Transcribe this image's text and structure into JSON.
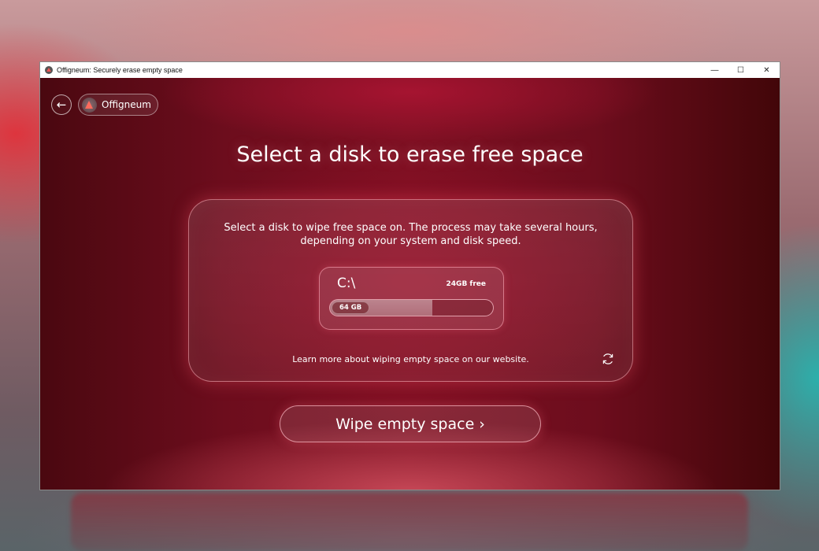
{
  "window": {
    "title": "Offigneum: Securely erase empty space",
    "controls": {
      "minimize": "—",
      "maximize": "☐",
      "close": "✕"
    }
  },
  "header": {
    "back_icon": "back-arrow-icon",
    "brand_name": "Offigneum"
  },
  "main": {
    "title": "Select a disk to erase free space",
    "description": "Select a disk to wipe free space on. The process may take several hours, depending on your system and disk speed.",
    "disk": {
      "name": "C:\\",
      "free": "24GB free",
      "size": "64 GB",
      "used_fraction": 0.63
    },
    "learn_more": "Learn more about wiping empty space on our website.",
    "refresh_icon": "refresh-icon",
    "action_label": "Wipe empty space ›"
  },
  "colors": {
    "accent": "#ff6a5c",
    "background_red": "#7c1022"
  }
}
